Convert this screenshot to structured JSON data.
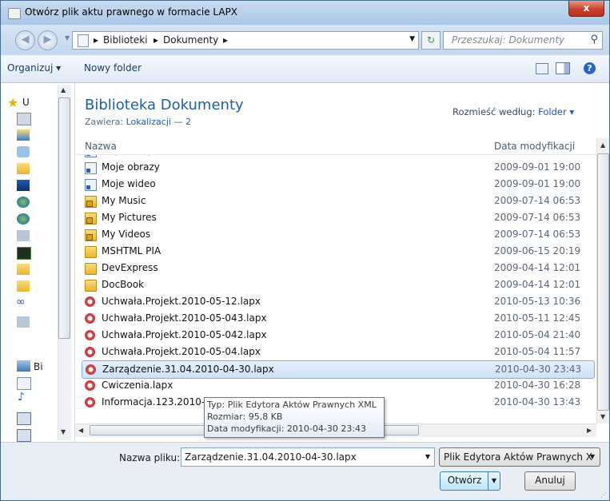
{
  "window": {
    "title": "Otwórz plik aktu prawnego w formacie LAPX",
    "close_label": "x"
  },
  "address": {
    "crumbs": [
      "Biblioteki",
      "Dokumenty"
    ],
    "search_placeholder": "Przeszukaj: Dokumenty"
  },
  "toolbar": {
    "organize_label": "Organizuj ▾",
    "new_folder_label": "Nowy folder"
  },
  "nav": {
    "label_favorites": "U",
    "label_libraries": "Bi"
  },
  "library": {
    "title": "Biblioteka Dokumenty",
    "contains_label": "Zawiera:",
    "contains_link": "Lokalizacji — 2",
    "arrange_label": "Rozmieść według:",
    "arrange_value": "Folder ▾"
  },
  "columns": {
    "name": "Nazwa",
    "date": "Data modyfikacji"
  },
  "files": [
    {
      "name": "Moje obrazy",
      "date": "2009-09-01 19:00",
      "icon": "shortcut"
    },
    {
      "name": "Moje wideo",
      "date": "2009-09-01 19:00",
      "icon": "shortcut"
    },
    {
      "name": "My Music",
      "date": "2009-07-14 06:53",
      "icon": "locked-folder"
    },
    {
      "name": "My Pictures",
      "date": "2009-07-14 06:53",
      "icon": "locked-folder"
    },
    {
      "name": "My Videos",
      "date": "2009-07-14 06:53",
      "icon": "locked-folder"
    },
    {
      "name": "MSHTML PIA",
      "date": "2009-06-15 20:19",
      "icon": "folder"
    },
    {
      "name": "DevExpress",
      "date": "2009-04-14 12:01",
      "icon": "folder"
    },
    {
      "name": "DocBook",
      "date": "2009-04-14 12:01",
      "icon": "folder"
    },
    {
      "name": "Uchwała.Projekt.2010-05-12.lapx",
      "date": "2010-05-13 10:36",
      "icon": "lapx"
    },
    {
      "name": "Uchwała.Projekt.2010-05-043.lapx",
      "date": "2010-05-11 12:45",
      "icon": "lapx"
    },
    {
      "name": "Uchwała.Projekt.2010-05-042.lapx",
      "date": "2010-05-04 21:40",
      "icon": "lapx"
    },
    {
      "name": "Uchwała.Projekt.2010-05-04.lapx",
      "date": "2010-05-04 11:57",
      "icon": "lapx"
    },
    {
      "name": "Zarządzenie.31.04.2010-04-30.lapx",
      "date": "2010-04-30 23:43",
      "icon": "lapx",
      "selected": true
    },
    {
      "name": "Cwiczenia.lapx",
      "date": "2010-04-30 16:28",
      "icon": "lapx"
    },
    {
      "name": "Informacja.123.2010-04",
      "date": "2010-04-30 13:43",
      "icon": "lapx"
    }
  ],
  "tooltip": {
    "type": "Typ: Plik Edytora Aktów Prawnych XML",
    "size": "Rozmiar: 95,8 KB",
    "modified": "Data modyfikacji: 2010-04-30 23:43"
  },
  "footer": {
    "filename_label": "Nazwa pliku:",
    "filename_value": "Zarządzenie.31.04.2010-04-30.lapx",
    "filetype_value": "Plik Edytora Aktów Prawnych X",
    "open_label": "Otwórz",
    "cancel_label": "Anuluj"
  },
  "colors": {
    "accent": "#1d5fa8",
    "selection": "#cde2f8",
    "close": "#c9412c"
  }
}
